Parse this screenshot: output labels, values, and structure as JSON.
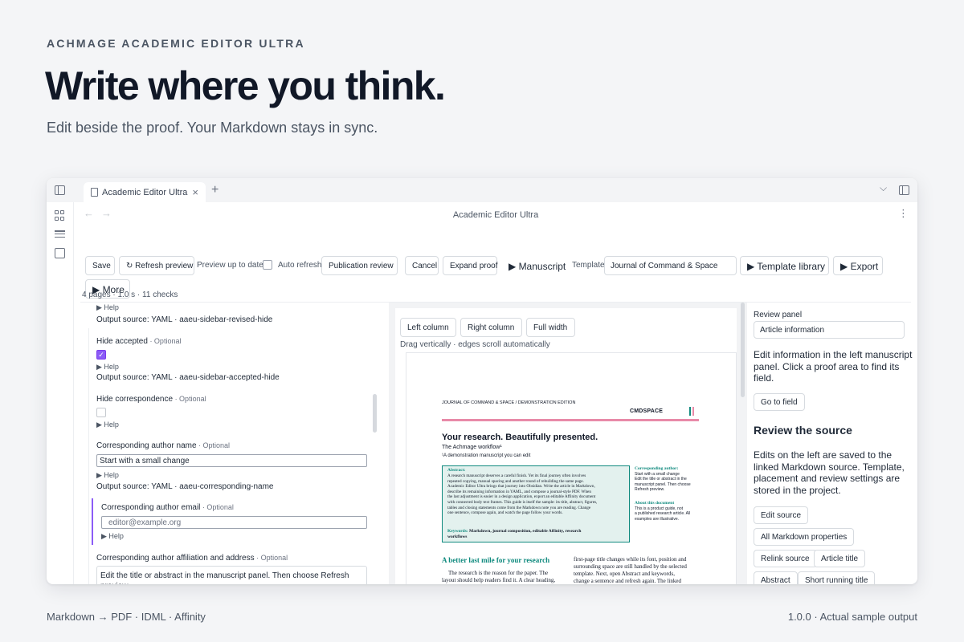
{
  "hero": {
    "eyebrow": "ACHMAGE ACADEMIC EDITOR ULTRA",
    "title": "Write where you think.",
    "subtitle": "Edit beside the proof. Your Markdown stays in sync."
  },
  "footer": {
    "left": "Markdown → PDF · IDML · Affinity",
    "right": "1.0.0 · Actual sample output"
  },
  "window": {
    "tab_label": "Academic Editor Ultra",
    "tab_close": "×",
    "new_tab": "+",
    "collapse": "⌵",
    "nav_back": "←",
    "nav_forward": "→",
    "nav_title": "Academic Editor Ultra",
    "nav_more": "⋮"
  },
  "toolbar": {
    "save": "Save",
    "refresh_preview": "↻ Refresh preview",
    "preview_status": "Preview up to date",
    "auto_refresh": "Auto refresh",
    "publication_review": "Publication review",
    "cancel": "Cancel",
    "expand_proof": "Expand proof",
    "manuscript": "▶ Manuscript",
    "template_label": "Template",
    "template_value": "Journal of Command & Space",
    "template_library": "▶ Template library",
    "export": "▶ Export",
    "more": "▶ More"
  },
  "status": "4 pages · 1.0 s · 11 checks",
  "left": {
    "help": "▶ Help",
    "src_revised": "Output source: YAML · aaeu-sidebar-revised-hide",
    "hide_accepted": "Hide accepted",
    "optional": " · Optional",
    "src_accepted": "Output source: YAML · aaeu-sidebar-accepted-hide",
    "hide_correspondence": "Hide correspondence",
    "corr_name_label": "Corresponding author name",
    "corr_name_value": "Start with a small change",
    "src_corr_name": "Output source: YAML · aaeu-corresponding-name",
    "corr_email_label": "Corresponding author email",
    "corr_email_placeholder": "editor@example.org",
    "corr_affil_label": "Corresponding author affiliation and address",
    "corr_affil_value": "Edit the title or abstract in the manuscript panel. Then choose Refresh preview."
  },
  "proof_controls": {
    "left_column": "Left column",
    "right_column": "Right column",
    "full_width": "Full width",
    "hint": "Drag vertically · edges scroll automatically"
  },
  "proof": {
    "running_head": "JOURNAL OF COMMAND & SPACE / DEMONSTRATION EDITION",
    "logo_text": "CMDSPACE",
    "heading": "Your research. Beautifully presented.",
    "subtitle": "The Achmage workflow¹",
    "footnote": "¹A demonstration manuscript you can edit",
    "abstract_label": "Abstract:",
    "abstract_lines": [
      "A research manuscript deserves a careful finish. Yet its final journey often involves",
      "repeated copying, manual spacing and another round of rebuilding the same page.",
      "Academic Editor Ultra brings that journey into Obsidian. Write the article in Markdown,",
      "describe its remaining information in YAML, and compose a journal-style PDF. When",
      "the last adjustment is easier in a design application, export an editable Affinity document",
      "with connected body text frames. This guide is itself the sample: its title, abstract, figures,",
      "tables and closing statements come from the Markdown note you are reading. Change",
      "one sentence, compose again, and watch the page follow your words."
    ],
    "keywords_label": "Keywords:",
    "keywords_lines": [
      "Markdown, journal composition, editable Affinity, research",
      "workflows"
    ],
    "side_corr_label": "Corresponding author:",
    "side_corr_lines": [
      "Start with a small change",
      "Edit the title or abstract in the",
      "manuscript panel. Then choose",
      "Refresh preview."
    ],
    "side_about_label": "About this document",
    "side_about_lines": [
      "This is a product guide, not",
      "a published research article. All",
      "examples are illustrative."
    ],
    "section_heading": "A better last mile for your research",
    "body_left": [
      "The research is the reason for the paper. The",
      "layout should help readers find it. A clear heading,"
    ],
    "body_right_1": "first-page title changes while its font, position and",
    "body_right_2": "surrounding space are still handled by the selected",
    "body_right_3": "template. Next, open Abstract and keywords,",
    "body_right_4": "change a sentence and refresh again. The linked"
  },
  "right": {
    "review_panel_label": "Review panel",
    "review_panel_value": "Article information",
    "description": "Edit information in the left manuscript panel. Click a proof area to find its field.",
    "go_to_field": "Go to field",
    "review_heading": "Review the source",
    "review_text": "Edits on the left are saved to the linked Markdown source. Template, placement and review settings are stored in the project.",
    "edit_source": "Edit source",
    "all_markdown": "All Markdown properties",
    "relink_source": "Relink source",
    "article_title": "Article title",
    "abstract": "Abstract",
    "short_running_title": "Short running title"
  },
  "colors": {
    "accent": "#8b5cf6",
    "proof_teal": "#0f8a7e",
    "proof_pink": "#e88aa8",
    "abstract_bg": "#e3f1ee"
  }
}
